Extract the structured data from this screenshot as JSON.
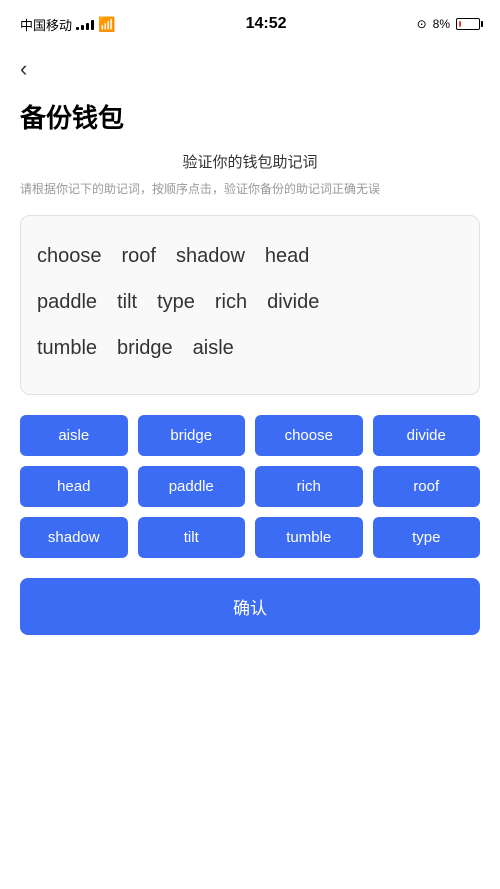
{
  "statusBar": {
    "carrier": "中国移动",
    "time": "14:52",
    "batteryPercent": "8%",
    "batteryLow": true
  },
  "backButton": {
    "label": "‹"
  },
  "pageTitle": "备份钱包",
  "instruction": {
    "title": "验证你的钱包助记词",
    "description": "请根据你记下的助记词，按顺序点击，验证你备份的助记词正确无误"
  },
  "displayWords": [
    [
      "choose",
      "roof",
      "shadow",
      "head"
    ],
    [
      "paddle",
      "tilt",
      "type",
      "rich",
      "divide"
    ],
    [
      "tumble",
      "bridge",
      "aisle"
    ]
  ],
  "wordButtons": [
    "aisle",
    "bridge",
    "choose",
    "divide",
    "head",
    "paddle",
    "rich",
    "roof",
    "shadow",
    "tilt",
    "tumble",
    "type"
  ],
  "confirmButton": {
    "label": "确认"
  },
  "colors": {
    "accent": "#3d6cf4",
    "batteryLow": "#ff3b30"
  }
}
